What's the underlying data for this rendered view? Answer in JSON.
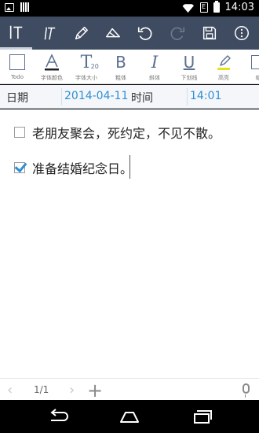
{
  "status_bar": {
    "time": "14:03",
    "sim_label": "E",
    "icons": [
      "image-icon",
      "signal-bars-icon",
      "wifi-icon",
      "sim-icon",
      "battery-icon"
    ]
  },
  "toolbar": {
    "buttons": [
      "text-style-icon",
      "italic-pen-icon",
      "pencil-icon",
      "eraser-icon",
      "undo-icon",
      "redo-icon",
      "save-icon",
      "more-icon"
    ]
  },
  "format": {
    "items": [
      {
        "label": "Todo",
        "icon": "checkbox-icon"
      },
      {
        "label": "字体颜色",
        "icon": "font-color-icon"
      },
      {
        "label": "字体大小",
        "icon": "font-size-icon",
        "size": "20"
      },
      {
        "label": "粗体",
        "icon": "bold-icon"
      },
      {
        "label": "斜体",
        "icon": "italic-icon"
      },
      {
        "label": "下划线",
        "icon": "underline-icon"
      },
      {
        "label": "高亮",
        "icon": "highlight-icon"
      },
      {
        "label": "缩",
        "icon": "indent-icon"
      }
    ]
  },
  "date_row": {
    "date_label": "日期",
    "date_value": "2014-04-11",
    "time_label": "时间",
    "time_value": "14:01"
  },
  "todos": [
    {
      "text": "老朋友聚会，死约定，不见不散。",
      "checked": false
    },
    {
      "text": "准备结婚纪念日。",
      "checked": true
    }
  ],
  "pager": {
    "page": "1/1"
  },
  "colors": {
    "toolbar_bg": "#3e4b61",
    "accent_blue": "#2f8fd8",
    "highlight_yellow": "#e6e01e"
  }
}
